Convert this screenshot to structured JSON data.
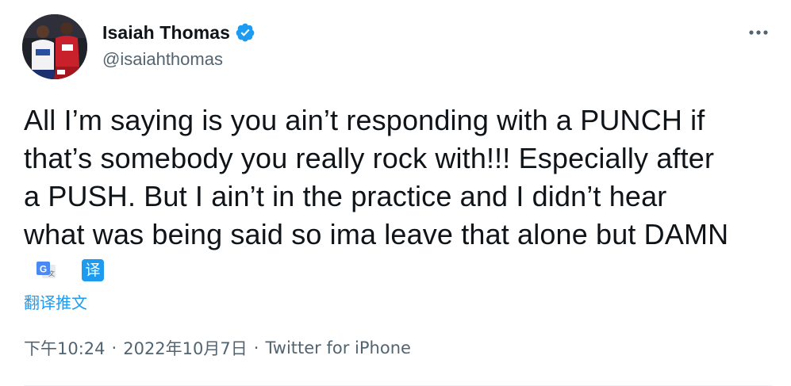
{
  "author": {
    "display_name": "Isaiah Thomas",
    "handle": "@isaiahthomas",
    "verified": true
  },
  "tweet": {
    "text": "All I’m saying is you ain’t responding with a PUNCH if\nthat’s somebody you really rock with!!! Especially after\na PUSH. But I ain’t in the practice and I didn’t hear\nwhat was being said so ima leave that alone but DAMN"
  },
  "translate": {
    "icon_label": "译",
    "link_label": "翻译推文"
  },
  "meta": {
    "time": "下午10:24",
    "separator": "·",
    "date": "2022年10月7日",
    "source": "Twitter for iPhone"
  },
  "icons": {
    "verified": "verified-badge-icon",
    "more": "more-options-icon",
    "google_translate": "google-translate-icon",
    "translate": "translate-icon"
  },
  "colors": {
    "accent": "#1d9bf0",
    "text_primary": "#0f1419",
    "text_secondary": "#536471"
  }
}
